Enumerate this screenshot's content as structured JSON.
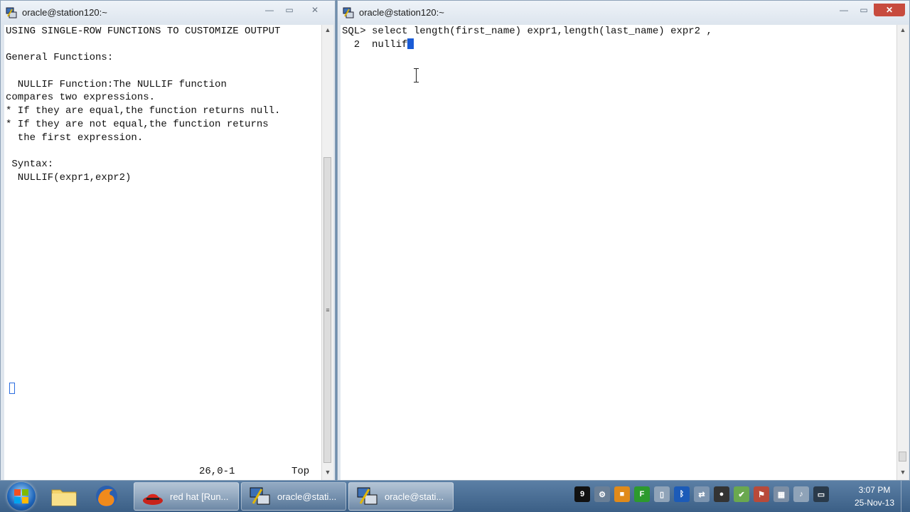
{
  "left_window": {
    "title": "oracle@station120:~",
    "lines": [
      "USING SINGLE-ROW FUNCTIONS TO CUSTOMIZE OUTPUT",
      "",
      "General Functions:",
      "",
      "  NULLIF Function:The NULLIF function",
      "compares two expressions.",
      "* If they are equal,the function returns null.",
      "* If they are not equal,the function returns",
      "  the first expression.",
      "",
      " Syntax:",
      "  NULLIF(expr1,expr2)"
    ],
    "status_position": "26,0-1",
    "status_scroll": "Top"
  },
  "right_window": {
    "title": "oracle@station120:~",
    "line1": "SQL> select length(first_name) expr1,length(last_name) expr2 ,",
    "line2": "  2  nullif"
  },
  "taskbar": {
    "tasks": [
      {
        "label": "red hat [Run..."
      },
      {
        "label": "oracle@stati..."
      },
      {
        "label": "oracle@stati..."
      }
    ],
    "tray": {
      "badge": "9"
    },
    "clock": {
      "time": "3:07 PM",
      "date": "25-Nov-13"
    }
  },
  "colors": {
    "cursor": "#1a5bd6",
    "close_button": "#c74b3e",
    "taskbar": "#3b5f86"
  }
}
